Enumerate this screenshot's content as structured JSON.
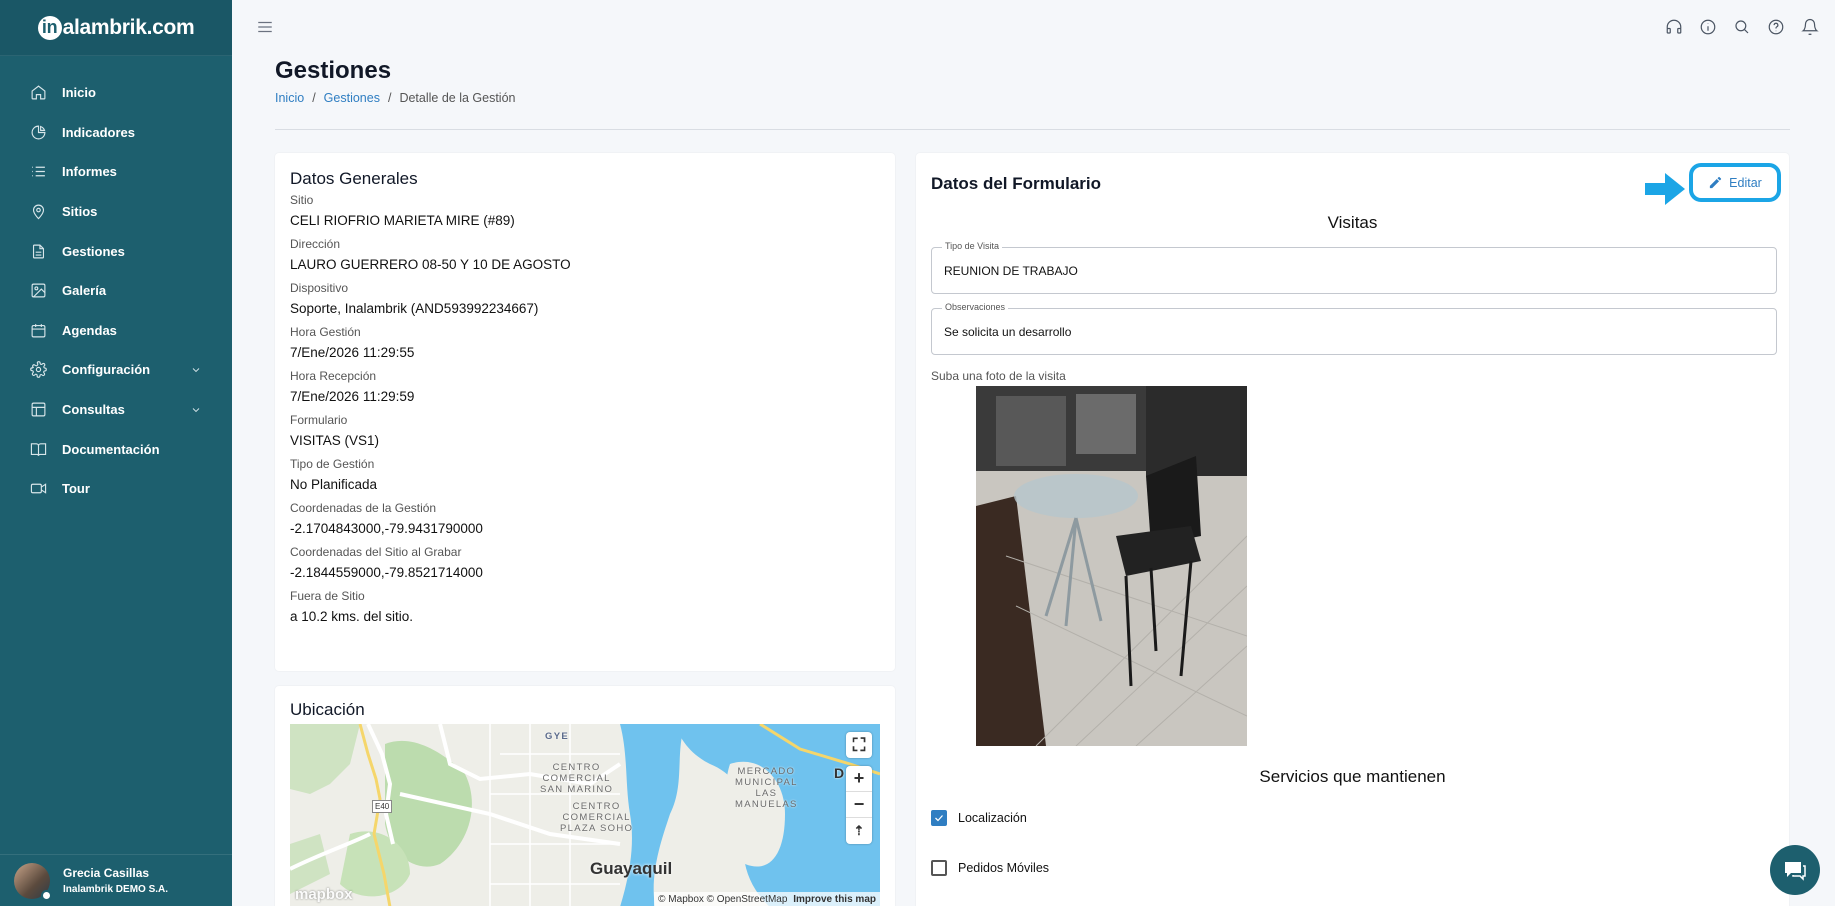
{
  "app": {
    "logo_text": "alambrik.com",
    "logo_letter": "in"
  },
  "sidebar": {
    "items": [
      {
        "label": "Inicio",
        "icon": "home-icon"
      },
      {
        "label": "Indicadores",
        "icon": "pie-chart-icon"
      },
      {
        "label": "Informes",
        "icon": "list-icon"
      },
      {
        "label": "Sitios",
        "icon": "map-pin-icon"
      },
      {
        "label": "Gestiones",
        "icon": "document-icon"
      },
      {
        "label": "Galería",
        "icon": "image-icon"
      },
      {
        "label": "Agendas",
        "icon": "calendar-icon"
      },
      {
        "label": "Configuración",
        "icon": "gear-icon"
      },
      {
        "label": "Consultas",
        "icon": "table-icon"
      },
      {
        "label": "Documentación",
        "icon": "book-icon"
      },
      {
        "label": "Tour",
        "icon": "video-icon"
      }
    ],
    "user": {
      "name": "Grecia Casillas",
      "org": "Inalambrik DEMO S.A."
    }
  },
  "header": {
    "title": "Gestiones",
    "breadcrumb": {
      "home": "Inicio",
      "section": "Gestiones",
      "current": "Detalle de la Gestión"
    }
  },
  "general": {
    "title": "Datos Generales",
    "fields": [
      {
        "label": "Sitio",
        "value": "CELI RIOFRIO MARIETA MIRE (#89)"
      },
      {
        "label": "Dirección",
        "value": "LAURO GUERRERO 08-50 Y 10 DE AGOSTO"
      },
      {
        "label": "Dispositivo",
        "value": "Soporte, Inalambrik (AND593992234667)"
      },
      {
        "label": "Hora Gestión",
        "value": "7/Ene/2026 11:29:55"
      },
      {
        "label": "Hora Recepción",
        "value": "7/Ene/2026 11:29:59"
      },
      {
        "label": "Formulario",
        "value": "VISITAS (VS1)"
      },
      {
        "label": "Tipo de Gestión",
        "value": "No Planificada"
      },
      {
        "label": "Coordenadas de la Gestión",
        "value": "-2.1704843000,-79.9431790000"
      },
      {
        "label": "Coordenadas del Sitio al Grabar",
        "value": "-2.1844559000,-79.8521714000"
      },
      {
        "label": "Fuera de Sitio",
        "value": "a 10.2 kms. del sitio."
      }
    ]
  },
  "location": {
    "title": "Ubicación",
    "map": {
      "labels": {
        "san_marino": "CENTRO\nCOMERCIAL\nSAN MARINO",
        "plaza_soho": "CENTRO\nCOMERCIAL\nPLAZA SOHO",
        "mercado": "MERCADO\nMUNICIPAL\nLAS\nMANUELAS",
        "gye": "GYE",
        "road": "E40",
        "city": "Guayaquil",
        "edge": "D"
      },
      "logo": "mapbox",
      "attribution": "© Mapbox © OpenStreetMap",
      "improve": "Improve this map"
    }
  },
  "form": {
    "title": "Datos del Formulario",
    "edit_label": "Editar",
    "subtitle": "Visitas",
    "tipo_visita": {
      "legend": "Tipo de Visita",
      "value": "REUNION DE TRABAJO"
    },
    "observaciones": {
      "legend": "Observaciones",
      "value": "Se solicita un desarrollo"
    },
    "photo_label": "Suba una foto de la visita",
    "services_title": "Servicios que mantienen",
    "services": [
      {
        "label": "Localización",
        "checked": true
      },
      {
        "label": "Pedidos Móviles",
        "checked": false
      }
    ]
  },
  "colors": {
    "sidebar": "#1d5f6e",
    "accent": "#2f7ec2",
    "highlight": "#1ba5e6"
  }
}
